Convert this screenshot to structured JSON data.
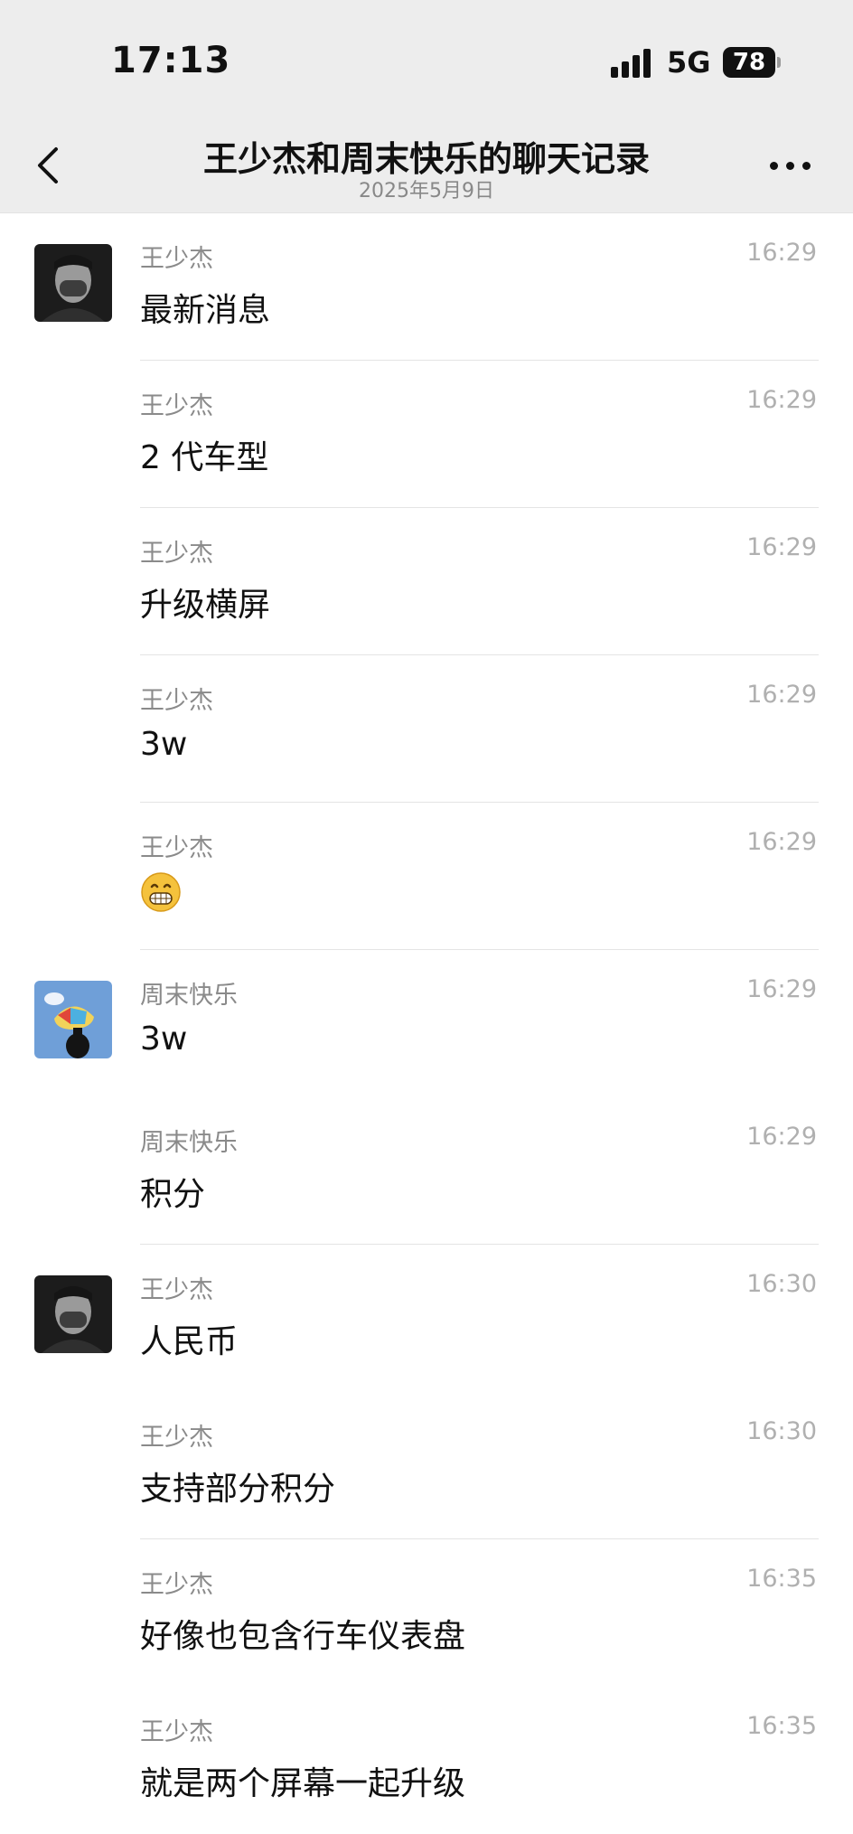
{
  "status_bar": {
    "time": "17:13",
    "network": "5G",
    "battery": "78"
  },
  "header": {
    "title": "王少杰和周末快乐的聊天记录",
    "date": "2025年5月9日"
  },
  "messages": [
    {
      "sender": "王少杰",
      "time": "16:29",
      "text": "最新消息",
      "avatar": "avatar-wang",
      "divider": true
    },
    {
      "sender": "王少杰",
      "time": "16:29",
      "text": "2 代车型",
      "avatar": "",
      "divider": true
    },
    {
      "sender": "王少杰",
      "time": "16:29",
      "text": "升级横屏",
      "avatar": "",
      "divider": true
    },
    {
      "sender": "王少杰",
      "time": "16:29",
      "text": "3w",
      "avatar": "",
      "divider": true
    },
    {
      "sender": "王少杰",
      "time": "16:29",
      "text": "",
      "emoji": "grin-emoji",
      "avatar": "",
      "divider": true
    },
    {
      "sender": "周末快乐",
      "time": "16:29",
      "text": "3w",
      "avatar": "avatar-zhou",
      "divider": false
    },
    {
      "sender": "周末快乐",
      "time": "16:29",
      "text": "积分",
      "avatar": "",
      "divider": true
    },
    {
      "sender": "王少杰",
      "time": "16:30",
      "text": "人民币",
      "avatar": "avatar-wang",
      "divider": false
    },
    {
      "sender": "王少杰",
      "time": "16:30",
      "text": "支持部分积分",
      "avatar": "",
      "divider": true
    },
    {
      "sender": "王少杰",
      "time": "16:35",
      "text": "好像也包含行车仪表盘",
      "avatar": "",
      "divider": false
    },
    {
      "sender": "王少杰",
      "time": "16:35",
      "text": "就是两个屏幕一起升级",
      "avatar": "",
      "divider": false
    }
  ]
}
